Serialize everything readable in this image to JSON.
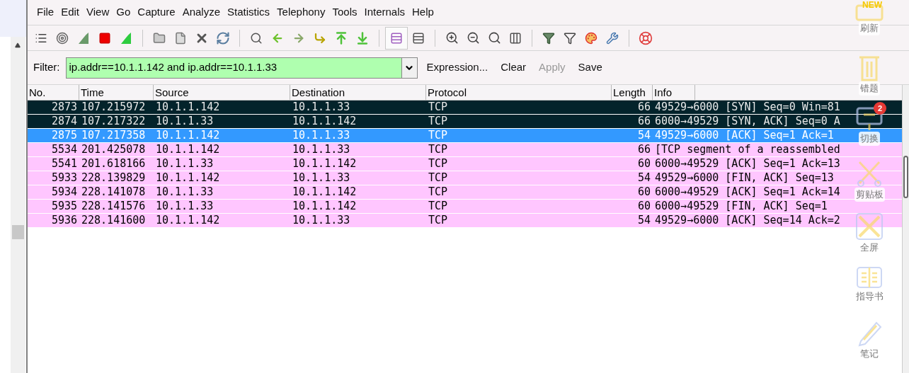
{
  "menu": [
    "File",
    "Edit",
    "View",
    "Go",
    "Capture",
    "Analyze",
    "Statistics",
    "Telephony",
    "Tools",
    "Internals",
    "Help"
  ],
  "filter": {
    "label": "Filter:",
    "value": "ip.addr==10.1.1.142 and ip.addr==10.1.1.33",
    "buttons": [
      {
        "label": "Expression...",
        "disabled": false
      },
      {
        "label": "Clear",
        "disabled": false
      },
      {
        "label": "Apply",
        "disabled": true
      },
      {
        "label": "Save",
        "disabled": false
      }
    ]
  },
  "table": {
    "columns": [
      "No.",
      "Time",
      "Source",
      "Destination",
      "Protocol",
      "Length",
      "Info"
    ],
    "rows": [
      {
        "cells": [
          "2873",
          "107.215972",
          "10.1.1.142",
          "10.1.1.33",
          "TCP",
          "66",
          "49529→6000 [SYN] Seq=0 Win=81"
        ],
        "selected": false,
        "color": "#03232b"
      },
      {
        "cells": [
          "2874",
          "107.217322",
          "10.1.1.33",
          "10.1.1.142",
          "TCP",
          "66",
          "6000→49529 [SYN, ACK] Seq=0 A"
        ],
        "selected": false,
        "color": "#03232b"
      },
      {
        "cells": [
          "2875",
          "107.217358",
          "10.1.1.142",
          "10.1.1.33",
          "TCP",
          "54",
          "49529→6000 [ACK] Seq=1 Ack=1"
        ],
        "selected": true,
        "color": "#3399ff"
      },
      {
        "cells": [
          "5534",
          "201.425078",
          "10.1.1.142",
          "10.1.1.33",
          "TCP",
          "66",
          "[TCP segment of a reassembled"
        ],
        "selected": false,
        "color": "#ffc6ff"
      },
      {
        "cells": [
          "5541",
          "201.618166",
          "10.1.1.33",
          "10.1.1.142",
          "TCP",
          "60",
          "6000→49529 [ACK] Seq=1 Ack=13"
        ],
        "selected": false,
        "color": "#ffc6ff"
      },
      {
        "cells": [
          "5933",
          "228.139829",
          "10.1.1.142",
          "10.1.1.33",
          "TCP",
          "54",
          "49529→6000 [FIN, ACK] Seq=13"
        ],
        "selected": false,
        "color": "#ffc6ff"
      },
      {
        "cells": [
          "5934",
          "228.141078",
          "10.1.1.33",
          "10.1.1.142",
          "TCP",
          "60",
          "6000→49529 [ACK] Seq=1 Ack=14"
        ],
        "selected": false,
        "color": "#ffc6ff"
      },
      {
        "cells": [
          "5935",
          "228.141576",
          "10.1.1.33",
          "10.1.1.142",
          "TCP",
          "60",
          "6000→49529 [FIN, ACK] Seq=1"
        ],
        "selected": false,
        "color": "#ffc6ff"
      },
      {
        "cells": [
          "5936",
          "228.141600",
          "10.1.1.142",
          "10.1.1.33",
          "TCP",
          "54",
          "49529→6000 [ACK] Seq=14 Ack=2"
        ],
        "selected": false,
        "color": "#ffc6ff"
      }
    ]
  },
  "overlay": [
    {
      "kind": "refresh",
      "label": "刷新",
      "badge": "NEW"
    },
    {
      "kind": "trash",
      "label": "错题"
    },
    {
      "kind": "switch",
      "label": "切换",
      "badge": "2"
    },
    {
      "kind": "clipboard",
      "label": "剪贴板"
    },
    {
      "kind": "fullscreen",
      "label": "全屏"
    },
    {
      "kind": "guide",
      "label": "指导书"
    },
    {
      "kind": "note",
      "label": "笔记"
    }
  ]
}
